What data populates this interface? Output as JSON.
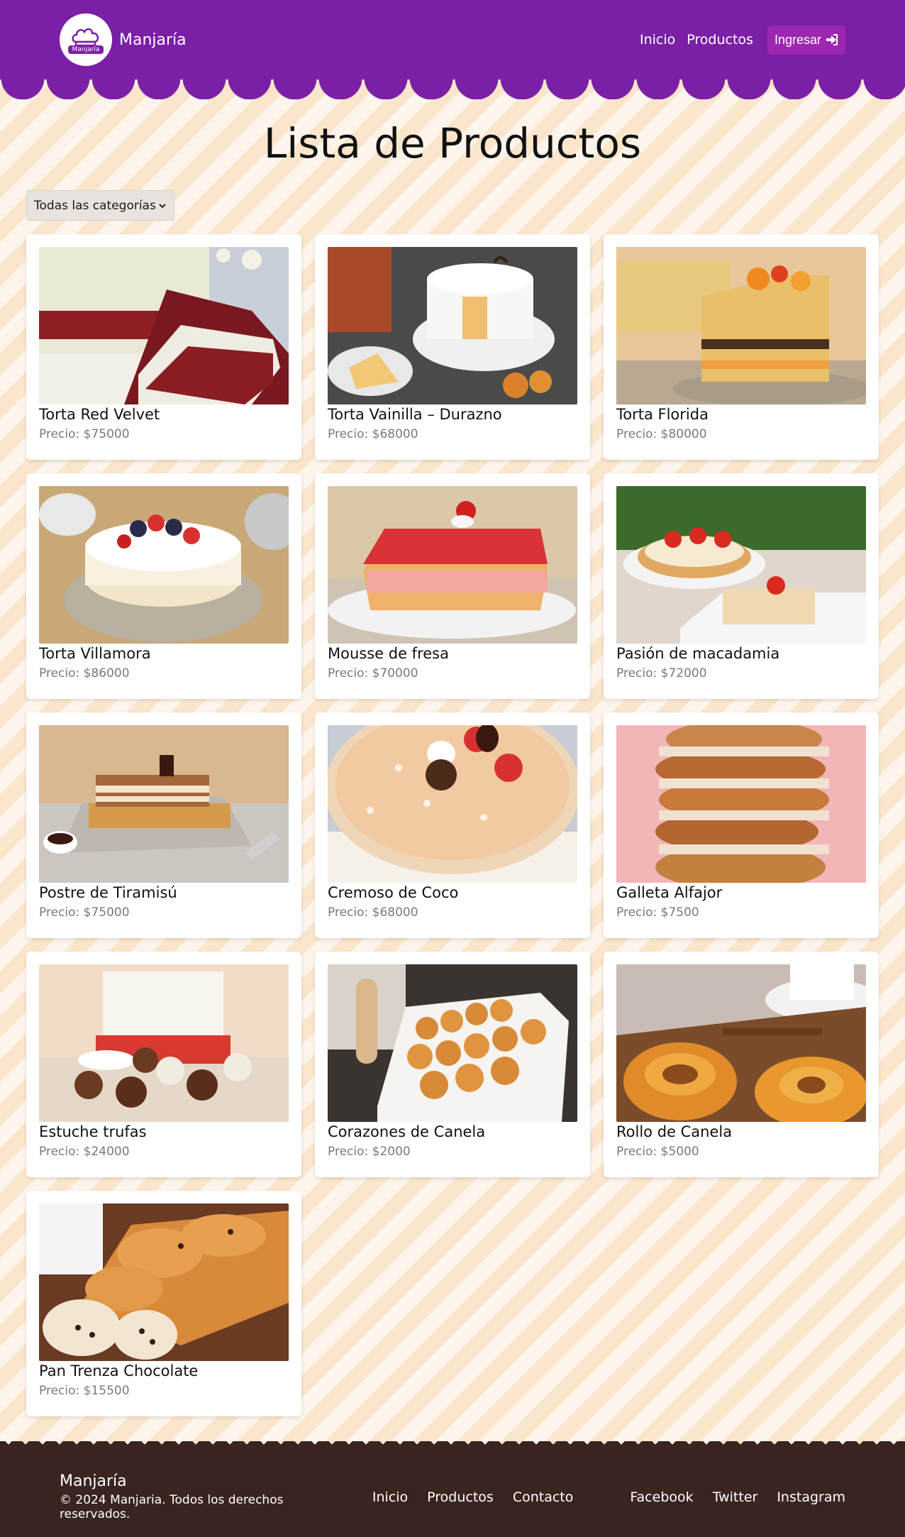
{
  "navbar": {
    "brand_name": "Manjaría",
    "logo_text": "Manjaría",
    "links": [
      "Inicio",
      "Productos"
    ],
    "login_label": "Ingresar"
  },
  "main": {
    "title": "Lista de Productos",
    "filter_selected": "Todas las categorías"
  },
  "products": [
    {
      "name": "Torta Red Velvet",
      "price": "Precio: $75000"
    },
    {
      "name": "Torta Vainilla – Durazno",
      "price": "Precio: $68000"
    },
    {
      "name": "Torta Florida",
      "price": "Precio: $80000"
    },
    {
      "name": "Torta Villamora",
      "price": "Precio: $86000"
    },
    {
      "name": "Mousse de fresa",
      "price": "Precio: $70000"
    },
    {
      "name": "Pasión de macadamia",
      "price": "Precio: $72000"
    },
    {
      "name": "Postre de Tiramisú",
      "price": "Precio: $75000"
    },
    {
      "name": "Cremoso de Coco",
      "price": "Precio: $68000"
    },
    {
      "name": "Galleta Alfajor",
      "price": "Precio: $7500"
    },
    {
      "name": "Estuche trufas",
      "price": "Precio: $24000"
    },
    {
      "name": "Corazones de Canela",
      "price": "Precio: $2000"
    },
    {
      "name": "Rollo de Canela",
      "price": "Precio: $5000"
    },
    {
      "name": "Pan Trenza Chocolate",
      "price": "Precio: $15500"
    }
  ],
  "footer": {
    "brand_name": "Manjaría",
    "copyright": "© 2024 Manjaria. Todos los derechos reservados.",
    "nav_links": [
      "Inicio",
      "Productos",
      "Contacto"
    ],
    "social_links": [
      "Facebook",
      "Twitter",
      "Instagram"
    ]
  },
  "colors": {
    "brand_purple": "#7b1fa6",
    "login_button": "#9c27b0",
    "footer_brown": "#3a2420"
  }
}
